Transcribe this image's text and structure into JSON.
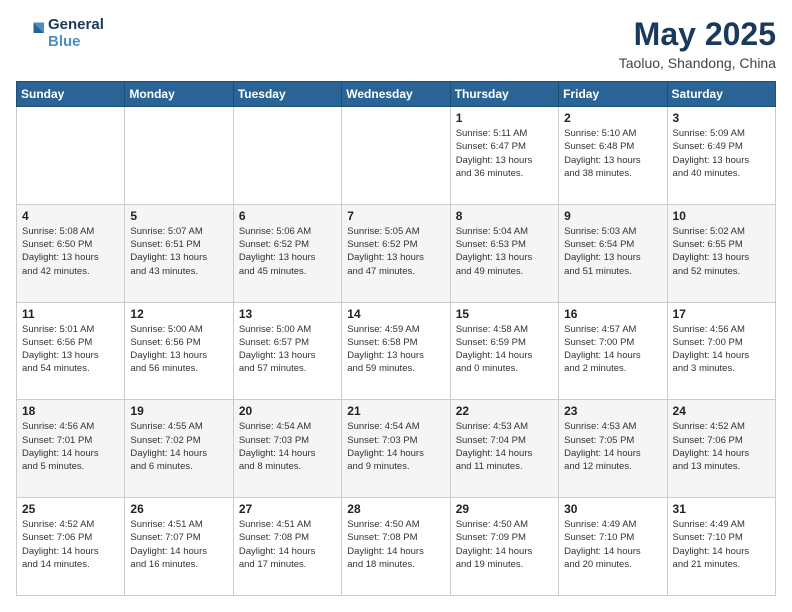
{
  "header": {
    "logo_line1": "General",
    "logo_line2": "Blue",
    "title": "May 2025",
    "subtitle": "Taoluo, Shandong, China"
  },
  "weekdays": [
    "Sunday",
    "Monday",
    "Tuesday",
    "Wednesday",
    "Thursday",
    "Friday",
    "Saturday"
  ],
  "weeks": [
    [
      {
        "day": "",
        "detail": ""
      },
      {
        "day": "",
        "detail": ""
      },
      {
        "day": "",
        "detail": ""
      },
      {
        "day": "",
        "detail": ""
      },
      {
        "day": "1",
        "detail": "Sunrise: 5:11 AM\nSunset: 6:47 PM\nDaylight: 13 hours\nand 36 minutes."
      },
      {
        "day": "2",
        "detail": "Sunrise: 5:10 AM\nSunset: 6:48 PM\nDaylight: 13 hours\nand 38 minutes."
      },
      {
        "day": "3",
        "detail": "Sunrise: 5:09 AM\nSunset: 6:49 PM\nDaylight: 13 hours\nand 40 minutes."
      }
    ],
    [
      {
        "day": "4",
        "detail": "Sunrise: 5:08 AM\nSunset: 6:50 PM\nDaylight: 13 hours\nand 42 minutes."
      },
      {
        "day": "5",
        "detail": "Sunrise: 5:07 AM\nSunset: 6:51 PM\nDaylight: 13 hours\nand 43 minutes."
      },
      {
        "day": "6",
        "detail": "Sunrise: 5:06 AM\nSunset: 6:52 PM\nDaylight: 13 hours\nand 45 minutes."
      },
      {
        "day": "7",
        "detail": "Sunrise: 5:05 AM\nSunset: 6:52 PM\nDaylight: 13 hours\nand 47 minutes."
      },
      {
        "day": "8",
        "detail": "Sunrise: 5:04 AM\nSunset: 6:53 PM\nDaylight: 13 hours\nand 49 minutes."
      },
      {
        "day": "9",
        "detail": "Sunrise: 5:03 AM\nSunset: 6:54 PM\nDaylight: 13 hours\nand 51 minutes."
      },
      {
        "day": "10",
        "detail": "Sunrise: 5:02 AM\nSunset: 6:55 PM\nDaylight: 13 hours\nand 52 minutes."
      }
    ],
    [
      {
        "day": "11",
        "detail": "Sunrise: 5:01 AM\nSunset: 6:56 PM\nDaylight: 13 hours\nand 54 minutes."
      },
      {
        "day": "12",
        "detail": "Sunrise: 5:00 AM\nSunset: 6:56 PM\nDaylight: 13 hours\nand 56 minutes."
      },
      {
        "day": "13",
        "detail": "Sunrise: 5:00 AM\nSunset: 6:57 PM\nDaylight: 13 hours\nand 57 minutes."
      },
      {
        "day": "14",
        "detail": "Sunrise: 4:59 AM\nSunset: 6:58 PM\nDaylight: 13 hours\nand 59 minutes."
      },
      {
        "day": "15",
        "detail": "Sunrise: 4:58 AM\nSunset: 6:59 PM\nDaylight: 14 hours\nand 0 minutes."
      },
      {
        "day": "16",
        "detail": "Sunrise: 4:57 AM\nSunset: 7:00 PM\nDaylight: 14 hours\nand 2 minutes."
      },
      {
        "day": "17",
        "detail": "Sunrise: 4:56 AM\nSunset: 7:00 PM\nDaylight: 14 hours\nand 3 minutes."
      }
    ],
    [
      {
        "day": "18",
        "detail": "Sunrise: 4:56 AM\nSunset: 7:01 PM\nDaylight: 14 hours\nand 5 minutes."
      },
      {
        "day": "19",
        "detail": "Sunrise: 4:55 AM\nSunset: 7:02 PM\nDaylight: 14 hours\nand 6 minutes."
      },
      {
        "day": "20",
        "detail": "Sunrise: 4:54 AM\nSunset: 7:03 PM\nDaylight: 14 hours\nand 8 minutes."
      },
      {
        "day": "21",
        "detail": "Sunrise: 4:54 AM\nSunset: 7:03 PM\nDaylight: 14 hours\nand 9 minutes."
      },
      {
        "day": "22",
        "detail": "Sunrise: 4:53 AM\nSunset: 7:04 PM\nDaylight: 14 hours\nand 11 minutes."
      },
      {
        "day": "23",
        "detail": "Sunrise: 4:53 AM\nSunset: 7:05 PM\nDaylight: 14 hours\nand 12 minutes."
      },
      {
        "day": "24",
        "detail": "Sunrise: 4:52 AM\nSunset: 7:06 PM\nDaylight: 14 hours\nand 13 minutes."
      }
    ],
    [
      {
        "day": "25",
        "detail": "Sunrise: 4:52 AM\nSunset: 7:06 PM\nDaylight: 14 hours\nand 14 minutes."
      },
      {
        "day": "26",
        "detail": "Sunrise: 4:51 AM\nSunset: 7:07 PM\nDaylight: 14 hours\nand 16 minutes."
      },
      {
        "day": "27",
        "detail": "Sunrise: 4:51 AM\nSunset: 7:08 PM\nDaylight: 14 hours\nand 17 minutes."
      },
      {
        "day": "28",
        "detail": "Sunrise: 4:50 AM\nSunset: 7:08 PM\nDaylight: 14 hours\nand 18 minutes."
      },
      {
        "day": "29",
        "detail": "Sunrise: 4:50 AM\nSunset: 7:09 PM\nDaylight: 14 hours\nand 19 minutes."
      },
      {
        "day": "30",
        "detail": "Sunrise: 4:49 AM\nSunset: 7:10 PM\nDaylight: 14 hours\nand 20 minutes."
      },
      {
        "day": "31",
        "detail": "Sunrise: 4:49 AM\nSunset: 7:10 PM\nDaylight: 14 hours\nand 21 minutes."
      }
    ]
  ]
}
